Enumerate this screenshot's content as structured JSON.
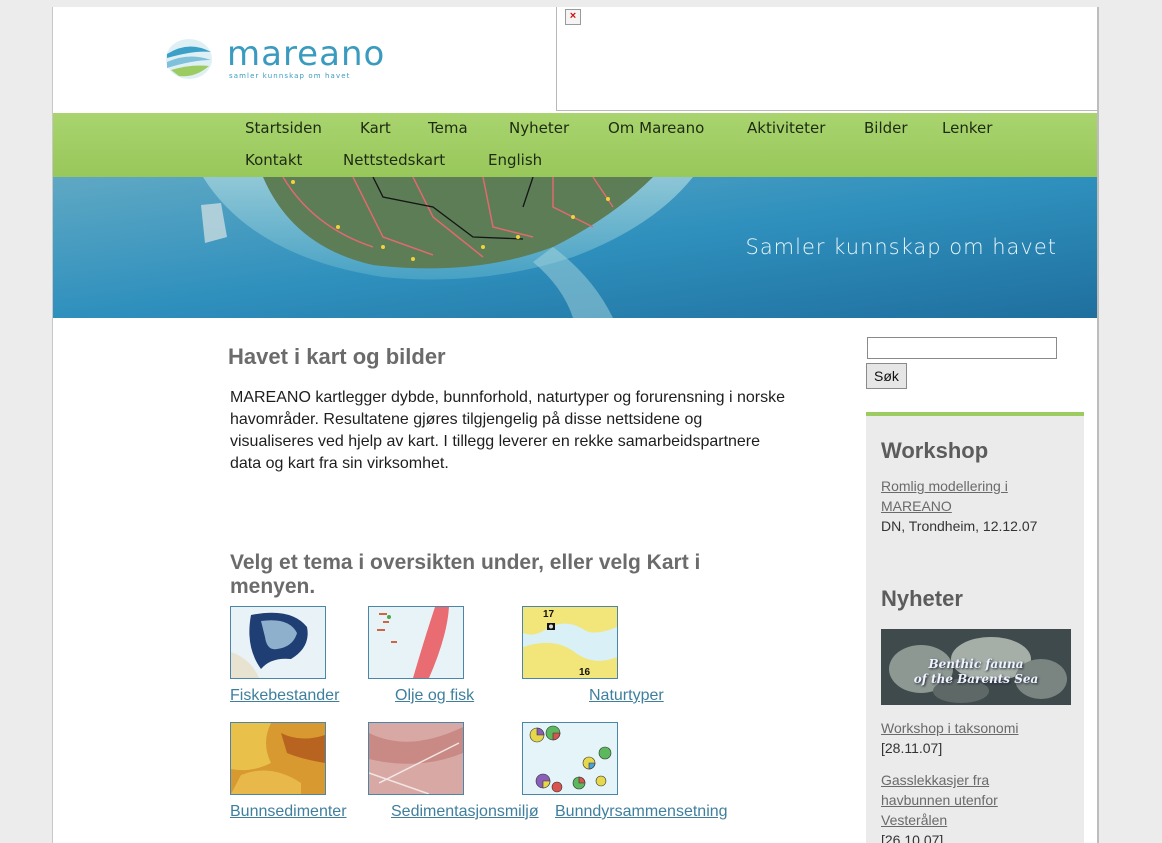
{
  "header": {
    "logo_name": "mareano",
    "logo_tagline": "samler kunnskap om havet",
    "banner_icon": "broken-image-icon"
  },
  "nav": {
    "items": [
      "Startsiden",
      "Kart",
      "Tema",
      "Nyheter",
      "Om Mareano",
      "Aktiviteter",
      "Bilder",
      "Lenker",
      "Kontakt",
      "Nettstedskart",
      "English"
    ]
  },
  "hero": {
    "caption": "Samler kunnskap om havet"
  },
  "main": {
    "title": "Havet i kart og bilder",
    "intro": "MAREANO kartlegger dybde, bunnforhold, naturtyper og forurensning i norske havområder. Resultatene gjøres tilgjengelig på disse nettsidene og visualiseres ved hjelp av kart. I tillegg leverer en rekke samarbeidspartnere data og kart fra sin virksomhet.",
    "subtitle": "Velg et tema i oversikten under, eller velg Kart i menyen.",
    "themes": [
      {
        "label": "Fiskebestander",
        "thumb_numbers": []
      },
      {
        "label": "Olje og fisk",
        "thumb_numbers": []
      },
      {
        "label": "Naturtyper",
        "thumb_numbers": [
          "17",
          "16"
        ]
      },
      {
        "label": "Bunnsedimenter",
        "thumb_numbers": []
      },
      {
        "label": "Sedimentasjonsmiljø",
        "thumb_numbers": []
      },
      {
        "label": "Bunndyrsammensetning",
        "thumb_numbers": []
      }
    ]
  },
  "search": {
    "value": "",
    "button_label": "Søk"
  },
  "sidebar": {
    "workshop": {
      "heading": "Workshop",
      "link": "Romlig modellering i MAREANO",
      "details": "DN, Trondheim, 12.12.07"
    },
    "news": {
      "heading": "Nyheter",
      "image_caption": [
        "Benthic fauna",
        "of the Barents Sea"
      ],
      "items": [
        {
          "title": "Workshop i taksonomi",
          "date": "[28.11.07]"
        },
        {
          "title": "Gasslekkasjer fra havbunnen utenfor Vesterålen",
          "date": "[26.10.07]"
        }
      ]
    }
  },
  "colors": {
    "nav_green": "#a9d46f",
    "link_blue": "#3f7f9e",
    "heading_gray": "#6b6b6b",
    "logo_blue": "#3a9bbf"
  }
}
